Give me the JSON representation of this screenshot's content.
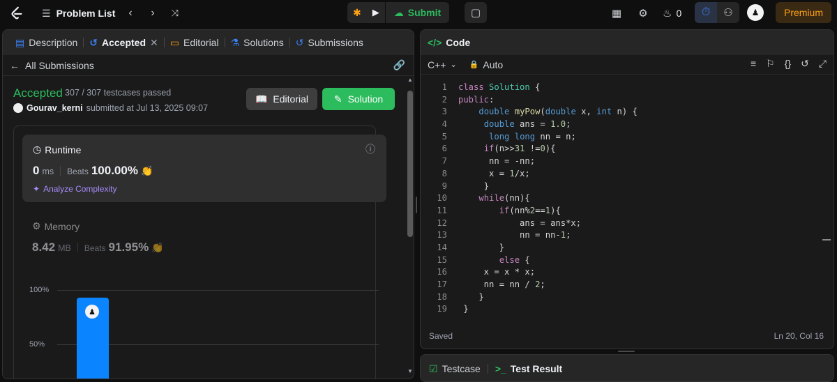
{
  "topbar": {
    "problem_list": "Problem List",
    "submit": "Submit",
    "streak_count": "0",
    "premium": "Premium"
  },
  "left_panel": {
    "tabs": [
      {
        "label": "Description"
      },
      {
        "label": "Accepted"
      },
      {
        "label": "Editorial"
      },
      {
        "label": "Solutions"
      },
      {
        "label": "Submissions"
      }
    ],
    "back_link": "All Submissions",
    "status": "Accepted",
    "testcases": "307 / 307 testcases passed",
    "username": "Gourav_kerni",
    "submitted_at": "submitted at Jul 13, 2025 09:07",
    "editorial_btn": "Editorial",
    "solution_btn": "Solution",
    "runtime": {
      "title": "Runtime",
      "value": "0",
      "unit": "ms",
      "beats_label": "Beats",
      "beats_value": "100.00%",
      "analyze": "Analyze Complexity"
    },
    "memory": {
      "title": "Memory",
      "value": "8.42",
      "unit": "MB",
      "beats_label": "Beats",
      "beats_value": "91.95%"
    },
    "chart": {
      "y_labels": [
        "100%",
        "50%"
      ],
      "bar_value": 100
    }
  },
  "code_panel": {
    "title": "Code",
    "language": "C++",
    "auto_label": "Auto",
    "saved": "Saved",
    "cursor": "Ln 20, Col 16",
    "line_numbers": [
      "1",
      "2",
      "3",
      "4",
      "5",
      "6",
      "7",
      "8",
      "9",
      "10",
      "11",
      "12",
      "13",
      "14",
      "15",
      "16",
      "17",
      "18",
      "19"
    ]
  },
  "bottom_panel": {
    "testcase": "Testcase",
    "test_result": "Test Result"
  },
  "colors": {
    "accent_green": "#2cbb5d",
    "premium_orange": "#ffa116",
    "bar_blue": "#0a84ff",
    "analyze_purple": "#a78bfa"
  }
}
